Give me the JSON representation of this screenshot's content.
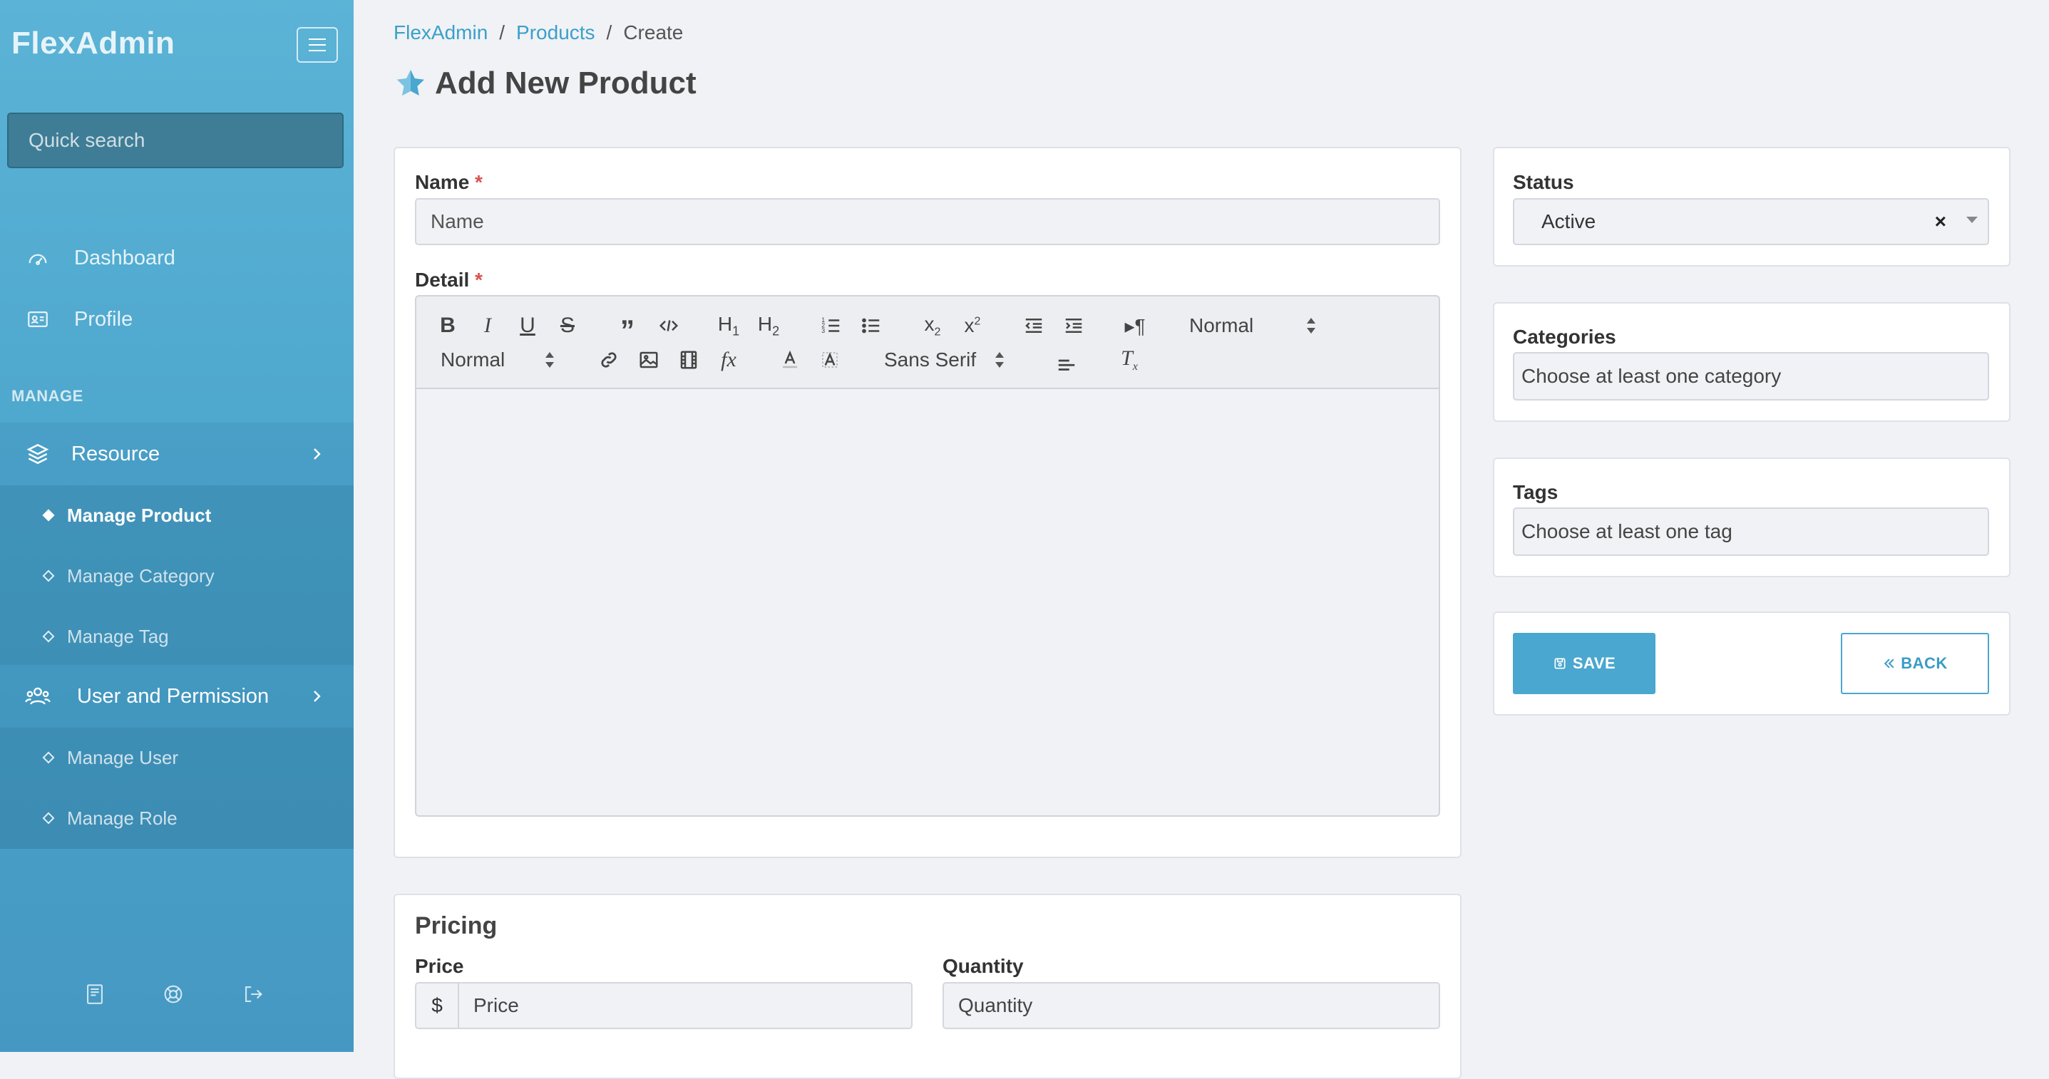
{
  "sidebar": {
    "brand": "FlexAdmin",
    "search_placeholder": "Quick search",
    "nav": [
      {
        "label": "Dashboard",
        "icon": "gauge-icon"
      },
      {
        "label": "Profile",
        "icon": "id-card-icon"
      }
    ],
    "section_label": "MANAGE",
    "groups": [
      {
        "label": "Resource",
        "icon": "layers-icon",
        "items": [
          {
            "label": "Manage Product",
            "active": true
          },
          {
            "label": "Manage Category",
            "active": false
          },
          {
            "label": "Manage Tag",
            "active": false
          }
        ]
      },
      {
        "label": "User and Permission",
        "icon": "users-icon",
        "items": [
          {
            "label": "Manage User",
            "active": false
          },
          {
            "label": "Manage Role",
            "active": false
          }
        ]
      }
    ],
    "footer_icons": [
      "book-icon",
      "lifebuoy-icon",
      "logout-icon"
    ]
  },
  "breadcrumb": [
    {
      "label": "FlexAdmin",
      "link": true
    },
    {
      "label": "Products",
      "link": true
    },
    {
      "label": "Create",
      "link": false
    }
  ],
  "page_title": "Add New Product",
  "form": {
    "name_label": "Name",
    "name_placeholder": "Name",
    "detail_label": "Detail",
    "required_mark": "*",
    "editor": {
      "header_select": "Normal",
      "size_select": "Normal",
      "font_select": "Sans Serif"
    }
  },
  "status": {
    "label": "Status",
    "value": "Active",
    "clear": "×"
  },
  "categories": {
    "label": "Categories",
    "placeholder": "Choose at least one category"
  },
  "tags": {
    "label": "Tags",
    "placeholder": "Choose at least one tag"
  },
  "actions": {
    "save": "SAVE",
    "back": "BACK"
  },
  "pricing": {
    "title": "Pricing",
    "price_label": "Price",
    "price_placeholder": "Price",
    "currency": "$",
    "quantity_label": "Quantity",
    "quantity_placeholder": "Quantity"
  },
  "colors": {
    "sidebar": "#4aa3cb",
    "accent": "#4aa7cf",
    "required": "#d9534f",
    "link": "#3aa0c9"
  }
}
